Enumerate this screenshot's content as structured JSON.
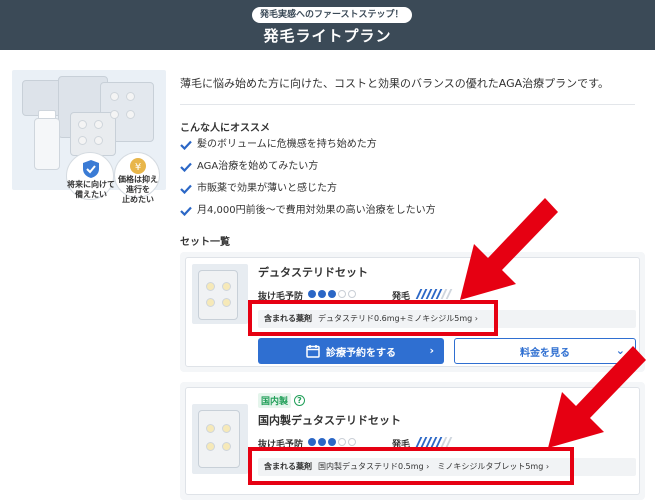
{
  "header": {
    "badge": "発毛実感へのファーストステップ！",
    "title": "発毛ライトプラン"
  },
  "hero": {
    "circle_left": "将来に向けて\n備えたい",
    "circle_right": "価格は抑え\n進行を\n止めたい"
  },
  "intro": "薄毛に悩み始めた方に向けた、コストと効果のバランスの優れたAGA治療プランです。",
  "recommend": {
    "heading": "こんな人にオススメ",
    "items": [
      "髪のボリュームに危機感を持ち始めた方",
      "AGA治療を始めてみたい方",
      "市販薬で効果が薄いと感じた方",
      "月4,000円前後〜で費用対効果の高い治療をしたい方"
    ]
  },
  "sets": {
    "heading": "セット一覧",
    "cards": [
      {
        "name": "デュタステリドセット",
        "attr1_label": "抜け毛予防",
        "attr1_level": 3,
        "attr2_label": "発毛",
        "ingredients_label": "含まれる薬剤",
        "ingredients": "デュタステリド0.6mg+ミノキシジル5mg ›",
        "reserve_button": "診療予約をする",
        "price_button": "料金を見る"
      },
      {
        "tag": "国内製",
        "name": "国内製デュタステリドセット",
        "attr1_label": "抜け毛予防",
        "attr1_level": 3,
        "attr2_label": "発毛",
        "ingredients_label": "含まれる薬剤",
        "ingredients": "国内製デュタステリド0.5mg ›　ミノキシジルタブレット5mg ›"
      }
    ]
  },
  "colors": {
    "header_bg": "#3b4a57",
    "accent": "#2f6fd1",
    "check": "#2b67c6",
    "annotation": "#e60012",
    "domestic_tag": "#23a05a"
  }
}
